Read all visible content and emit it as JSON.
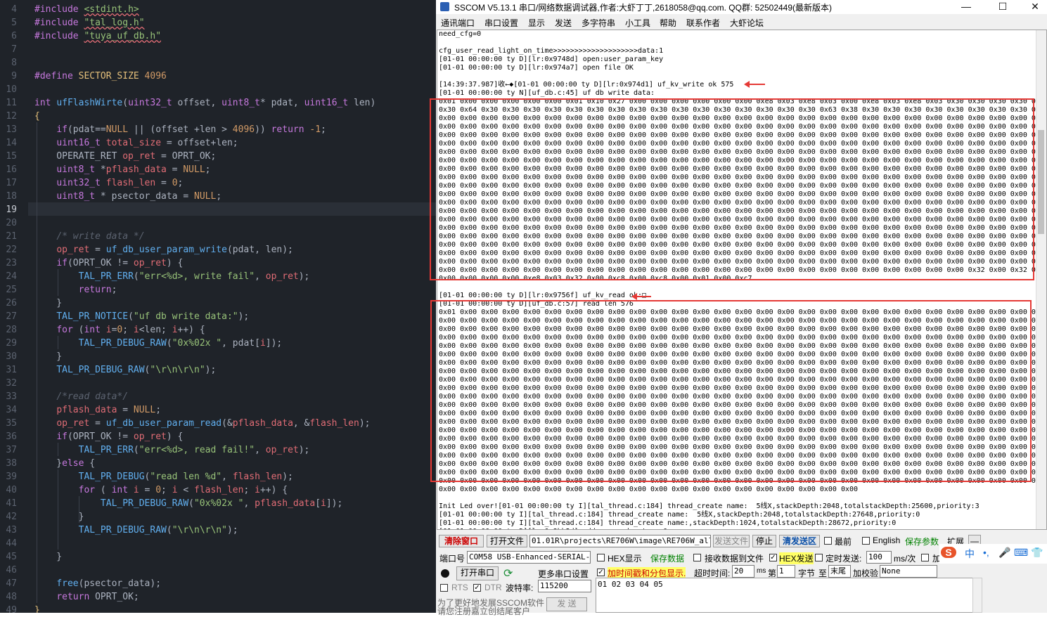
{
  "editor": {
    "line_numbers": [
      "4",
      "5",
      "6",
      "7",
      "8",
      "9",
      "10",
      "11",
      "12",
      "13",
      "14",
      "15",
      "16",
      "17",
      "18",
      "19",
      "20",
      "21",
      "22",
      "23",
      "24",
      "25",
      "26",
      "27",
      "28",
      "29",
      "30",
      "31",
      "32",
      "33",
      "34",
      "35",
      "36",
      "37",
      "38",
      "39",
      "40",
      "41",
      "42",
      "43",
      "44",
      "45",
      "46",
      "47",
      "48",
      "49"
    ],
    "current_line": "19"
  },
  "app": {
    "title": "SSCOM V5.13.1 串口/网络数据调试器,作者:大虾丁丁,2618058@qq.com. QQ群: 52502449(最新版本)",
    "window_buttons": {
      "minimize": "—",
      "maximize": "☐",
      "close": "✕"
    },
    "menu": [
      "通讯端口",
      "串口设置",
      "显示",
      "发送",
      "多字符串",
      "小工具",
      "帮助",
      "联系作者",
      "大虾论坛"
    ]
  },
  "terminal": {
    "write_rows": [
      "0x01 0x00 0x00 0x00 0x00 0x00 0x01 0x10 0x27 0x00 0x00 0x00 0x00 0x00 0x00 0xe8 0x03 0xe8 0x03 0x00 0xe8 0x03 0xe8 0x03 0x30 0x30 0x30 0x30 0x65",
      "0x30 0x64 0x30 0x30 0x30 0x30 0x30 0x30 0x30 0x30 0x30 0x30 0x30 0x30 0x30 0x30 0x30 0x30 0x63 0x38 0x30 0x30 0x30 0x30 0x30 0x30 0x30 0x30 0x30",
      "0x00 0x00 0x00 0x00 0x00 0x00 0x00 0x00 0x00 0x00 0x00 0x00 0x00 0x00 0x00 0x00 0x00 0x00 0x00 0x00 0x00 0x00 0x00 0x00 0x00 0x00 0x00 0x00 0x00",
      "0x00 0x00 0x00 0x00 0x00 0x00 0x00 0x00 0x00 0x00 0x00 0x00 0x00 0x00 0x00 0x00 0x00 0x00 0x00 0x00 0x00 0x00 0x00 0x00 0x00 0x00 0x00 0x00 0x00",
      "0x00 0x00 0x00 0x00 0x00 0x00 0x00 0x00 0x00 0x00 0x00 0x00 0x00 0x00 0x00 0x00 0x00 0x00 0x00 0x00 0x00 0x00 0x00 0x00 0x00 0x00 0x00 0x00 0x00",
      "0x00 0x00 0x00 0x00 0x00 0x00 0x00 0x00 0x00 0x00 0x00 0x00 0x00 0x00 0x00 0x00 0x00 0x00 0x00 0x00 0x00 0x00 0x00 0x00 0x00 0x00 0x00 0x00 0x00",
      "0x00 0x00 0x00 0x00 0x00 0x00 0x00 0x00 0x00 0x00 0x00 0x00 0x00 0x00 0x00 0x00 0x00 0x00 0x00 0x00 0x00 0x00 0x00 0x00 0x00 0x00 0x00 0x00 0x00",
      "0x00 0x00 0x00 0x00 0x00 0x00 0x00 0x00 0x00 0x00 0x00 0x00 0x00 0x00 0x00 0x00 0x00 0x00 0x00 0x00 0x00 0x00 0x00 0x00 0x00 0x00 0x00 0x00 0x00",
      "0x00 0x00 0x00 0x00 0x00 0x00 0x00 0x00 0x00 0x00 0x00 0x00 0x00 0x00 0x00 0x00 0x00 0x00 0x00 0x00 0x00 0x00 0x00 0x00 0x00 0x00 0x00 0x00 0x00",
      "0x00 0x00 0x00 0x00 0x00 0x00 0x00 0x00 0x00 0x00 0x00 0x00 0x00 0x00 0x00 0x00 0x00 0x00 0x00 0x00 0x00 0x00 0x00 0x00 0x00 0x00 0x00 0x00 0x00",
      "0x00 0x00 0x00 0x00 0x00 0x00 0x00 0x00 0x00 0x00 0x00 0x00 0x00 0x00 0x00 0x00 0x00 0x00 0x00 0x00 0x00 0x00 0x00 0x00 0x00 0x00 0x00 0x00 0x00",
      "0x00 0x00 0x00 0x00 0x00 0x00 0x00 0x00 0x00 0x00 0x00 0x00 0x00 0x00 0x00 0x00 0x00 0x00 0x00 0x00 0x00 0x00 0x00 0x00 0x00 0x00 0x00 0x00 0x00",
      "0x00 0x00 0x00 0x00 0x00 0x00 0x00 0x00 0x00 0x00 0x00 0x00 0x00 0x00 0x00 0x00 0x00 0x00 0x00 0x00 0x00 0x00 0x00 0x00 0x00 0x00 0x00 0x00 0x00",
      "0x00 0x00 0x00 0x00 0x00 0x00 0x00 0x00 0x00 0x00 0x00 0x00 0x00 0x00 0x00 0x00 0x00 0x00 0x00 0x00 0x00 0x00 0x00 0x00 0x00 0x00 0x00 0x00 0x00",
      "0x00 0x00 0x00 0x00 0x00 0x00 0x00 0x00 0x00 0x00 0x00 0x00 0x00 0x00 0x00 0x00 0x00 0x00 0x00 0x00 0x00 0x00 0x00 0x00 0x00 0x00 0x00 0x00 0x00",
      "0x00 0x00 0x00 0x00 0x00 0x00 0x00 0x00 0x00 0x00 0x00 0x00 0x00 0x00 0x00 0x00 0x00 0x00 0x00 0x00 0x00 0x00 0x00 0x00 0x00 0x00 0x00 0x00 0x00",
      "0x00 0x00 0x00 0x00 0x00 0x00 0x00 0x00 0x00 0x00 0x00 0x00 0x00 0x00 0x00 0x00 0x00 0x00 0x00 0x00 0x00 0x00 0x00 0x00 0x00 0x00 0x00 0x00 0x00",
      "0x00 0x00 0x00 0x00 0x00 0x00 0x00 0x00 0x00 0x00 0x00 0x00 0x00 0x00 0x00 0x00 0x00 0x00 0x00 0x00 0x00 0x00 0x00 0x00 0x00 0x00 0x00 0x00 0x00",
      "0x00 0x00 0x00 0x00 0x00 0x00 0x00 0x00 0x00 0x00 0x00 0x00 0x00 0x00 0x00 0x00 0x00 0x00 0x00 0x00 0x00 0x00 0x00 0x00 0x00 0x00 0x00 0x00 0x00",
      "0x00 0x00 0x00 0x00 0x00 0x00 0x00 0x00 0x00 0x00 0x00 0x00 0x00 0x00 0x00 0x00 0x00 0x00 0x00 0x00 0x00 0x00 0x00 0x00 0x00 0x00 0x00 0x00 0x00",
      "0x00 0x00 0x00 0x00 0x00 0x00 0x00 0x00 0x00 0x00 0x00 0x00 0x00 0x00 0x00 0x00 0x00 0x00 0x00 0x00 0x00 0x00 0x00 0x00 0x00 0x32 0x00 0x32 0x00 0x00 0x00",
      "0x00 0x00 0x00 0x00 0xe8 0x03 0x32 0x00 0xc8 0x00 0xc8 0x00 0x01 0x00 0xc7"
    ],
    "read_rows": [
      "0x01 0x00 0x00 0x00 0x00 0x00 0x00 0x00 0x00 0x00 0x00 0x00 0x00 0x00 0x00 0x00 0x00 0x00 0x00 0x00 0x00 0x00 0x00 0x00 0x00 0x00 0x00 0x00 0x00",
      "0x00 0x00 0x00 0x00 0x00 0x00 0x00 0x00 0x00 0x00 0x00 0x00 0x00 0x00 0x00 0x00 0x00 0x00 0x00 0x00 0x00 0x00 0x00 0x00 0x00 0x00 0x00 0x00 0x00",
      "0x00 0x00 0x00 0x00 0x00 0x00 0x00 0x00 0x00 0x00 0x00 0x00 0x00 0x00 0x00 0x00 0x00 0x00 0x00 0x00 0x00 0x00 0x00 0x00 0x00 0x00 0x00 0x00 0x00",
      "0x00 0x00 0x00 0x00 0x00 0x00 0x00 0x00 0x00 0x00 0x00 0x00 0x00 0x00 0x00 0x00 0x00 0x00 0x00 0x00 0x00 0x00 0x00 0x00 0x00 0x00 0x00 0x00 0x00",
      "0x00 0x00 0x00 0x00 0x00 0x00 0x00 0x00 0x00 0x00 0x00 0x00 0x00 0x00 0x00 0x00 0x00 0x00 0x00 0x00 0x00 0x00 0x00 0x00 0x00 0x00 0x00 0x00 0x00",
      "0x00 0x00 0x00 0x00 0x00 0x00 0x00 0x00 0x00 0x00 0x00 0x00 0x00 0x00 0x00 0x00 0x00 0x00 0x00 0x00 0x00 0x00 0x00 0x00 0x00 0x00 0x00 0x00 0x00",
      "0x00 0x00 0x00 0x00 0x00 0x00 0x00 0x00 0x00 0x00 0x00 0x00 0x00 0x00 0x00 0x00 0x00 0x00 0x00 0x00 0x00 0x00 0x00 0x00 0x00 0x00 0x00 0x00 0x00",
      "0x00 0x00 0x00 0x00 0x00 0x00 0x00 0x00 0x00 0x00 0x00 0x00 0x00 0x00 0x00 0x00 0x00 0x00 0x00 0x00 0x00 0x00 0x00 0x00 0x00 0x00 0x00 0x00 0x00",
      "0x00 0x00 0x00 0x00 0x00 0x00 0x00 0x00 0x00 0x00 0x00 0x00 0x00 0x00 0x00 0x00 0x00 0x00 0x00 0x00 0x00 0x00 0x00 0x00 0x00 0x00 0x00 0x00 0x00",
      "0x00 0x00 0x00 0x00 0x00 0x00 0x00 0x00 0x00 0x00 0x00 0x00 0x00 0x00 0x00 0x00 0x00 0x00 0x00 0x00 0x00 0x00 0x00 0x00 0x00 0x00 0x00 0x00 0x00",
      "0x00 0x00 0x00 0x00 0x00 0x00 0x00 0x00 0x00 0x00 0x00 0x00 0x00 0x00 0x00 0x00 0x00 0x00 0x00 0x00 0x00 0x00 0x00 0x00 0x00 0x00 0x00 0x00 0x00",
      "0x00 0x00 0x00 0x00 0x00 0x00 0x00 0x00 0x00 0x00 0x00 0x00 0x00 0x00 0x00 0x00 0x00 0x00 0x00 0x00 0x00 0x00 0x00 0x00 0x00 0x00 0x00 0x00 0x00",
      "0x00 0x00 0x00 0x00 0x00 0x00 0x00 0x00 0x00 0x00 0x00 0x00 0x00 0x00 0x00 0x00 0x00 0x00 0x00 0x00 0x00 0x00 0x00 0x00 0x00 0x00 0x00 0x00 0x00",
      "0x00 0x00 0x00 0x00 0x00 0x00 0x00 0x00 0x00 0x00 0x00 0x00 0x00 0x00 0x00 0x00 0x00 0x00 0x00 0x00 0x00 0x00 0x00 0x00 0x00 0x00 0x00 0x00 0x00",
      "0x00 0x00 0x00 0x00 0x00 0x00 0x00 0x00 0x00 0x00 0x00 0x00 0x00 0x00 0x00 0x00 0x00 0x00 0x00 0x00 0x00 0x00 0x00 0x00 0x00 0x00 0x00 0x00 0x00",
      "0x00 0x00 0x00 0x00 0x00 0x00 0x00 0x00 0x00 0x00 0x00 0x00 0x00 0x00 0x00 0x00 0x00 0x00 0x00 0x00 0x00 0x00 0x00 0x00 0x00 0x00 0x00 0x00 0x00",
      "0x00 0x00 0x00 0x00 0x00 0x00 0x00 0x00 0x00 0x00 0x00 0x00 0x00 0x00 0x00 0x00 0x00 0x00 0x00 0x00 0x00 0x00 0x00 0x00 0x00 0x00 0x00 0x00 0x00",
      "0x00 0x00 0x00 0x00 0x00 0x00 0x00 0x00 0x00 0x00 0x00 0x00 0x00 0x00 0x00 0x00 0x00 0x00 0x00 0x00 0x00 0x00 0x00 0x00 0x00 0x00 0x00 0x00 0x00",
      "0x00 0x00 0x00 0x00 0x00 0x00 0x00 0x00 0x00 0x00 0x00 0x00 0x00 0x00 0x00 0x00 0x00 0x00 0x00 0x00 0x00 0x00 0x00 0x00 0x00 0x00 0x00 0x00 0x00",
      "0x00 0x00 0x00 0x00 0x00 0x00 0x00 0x00 0x00 0x00 0x00 0x00 0x00 0x00 0x00 0x00 0x00 0x00 0x00 0x00 0x00 0x00 0x00 0x00 0x00 0x00 0x00 0x00 0x00",
      "0x00 0x00 0x00 0x00 0x00 0x00 0x00 0x00 0x00 0x00 0x00 0x00 0x00 0x00 0x00 0x00 0x00 0x00 0x00 0x00 0x00 0x00 0x00 0x00 0x00 0x00 0x00 0x00 0x00",
      "0x00 0x00 0x00 0x00 0x00 0x00 0x00 0x00 0x00 0x00 0x00 0x00 0x00 0x00 0x00 0x00 0x00 0x00 0x00 0x00"
    ],
    "pre_lines": [
      "need_cfg=0",
      "",
      "cfg_user_read_light_on_time>>>>>>>>>>>>>>>>>>>>data:1",
      "[01-01 00:00:00 ty D][lr:0x9748d] open:user_param_key",
      "[01-01 00:00:00 ty D][lr:0x974a7] open file OK",
      "",
      "[14:39:37.987]收←◆[01-01 00:00:00 ty D][lr:0x974d1] uf_kv_write ok 575",
      "[01-01 00:00:00 ty N][uf_db.c:45] uf db write data:"
    ],
    "mid_lines": [
      "",
      "[01-01 00:00:00 ty D][lr:0x9756f] uf_kv_read ok:□",
      "[01-01 00:00:00 ty D][uf_db.c:57] read len 576"
    ],
    "post_lines": [
      "",
      "Init Led over![01-01 00:00:00 ty I][tal_thread.c:184] thread_create name:  5线X,stackDepth:2048,totalstackDepth:25600,priority:3",
      "[01-01 00:00:00 ty I][tal_thread.c:184] thread_create name:  5线X,stackDepth:2048,totalstackDepth:27648,priority:0",
      "[01-01 00:00:00 ty I][tal_thread.c:184] thread_create name:,stackDepth:1024,totalstackDepth:28672,priority:0",
      "[01-01 00:00:00 ty D][lr:0x8bb2d] add new node, type:0",
      "[01-01 00:00:00 ty D][lr:0x8bb2d] add new node, type:1"
    ]
  },
  "panel": {
    "clear_btn": "清除窗口",
    "open_file_btn": "打开文件",
    "file_path": "01.01R\\projects\\RE706W\\image\\RE706W_all.bin",
    "send_file_btn": "发送文件",
    "stop_btn": "停止",
    "clear_send_btn": "清发送区",
    "top_label": "最前",
    "english_label": "English",
    "save_params_btn": "保存参数",
    "expand_btn": "扩展",
    "collapse_btn": "—",
    "port_label": "端口号",
    "port_value": "COM58 USB-Enhanced-SERIAL-",
    "hex_display": "HEX显示",
    "save_data_btn": "保存数据",
    "recv_to_file": "接收数据到文件",
    "hex_send": "HEX发送",
    "timed_send": "定时发送:",
    "timed_value": "100",
    "timed_unit": "ms/次",
    "cr_label": "加",
    "open_port_btn": "打开串口",
    "more_settings": "更多串口设置",
    "timestamp_label": "加时间戳和分包显示.",
    "timeout_label": "超时时间:",
    "timeout_value": "20",
    "timeout_unit": "ms",
    "byte_from_label": "第",
    "byte_from_value": "1",
    "byte_unit_label": "字节",
    "to_label": "至",
    "byte_to_value": "末尾",
    "checksum_label": "加校验",
    "checksum_value": "None",
    "rts_label": "RTS",
    "dtr_label": "DTR",
    "baud_label": "波特率:",
    "baud_value": "115200",
    "send_text": "01 02 03 04 05",
    "promo_line1": "为了更好地发展SSCOM软件",
    "promo_line2": "请您注册嘉立创结尾客户",
    "send_btn": "发 送",
    "ime": [
      "S",
      "中",
      "•,",
      "🎤",
      "⌨",
      "👕"
    ]
  }
}
